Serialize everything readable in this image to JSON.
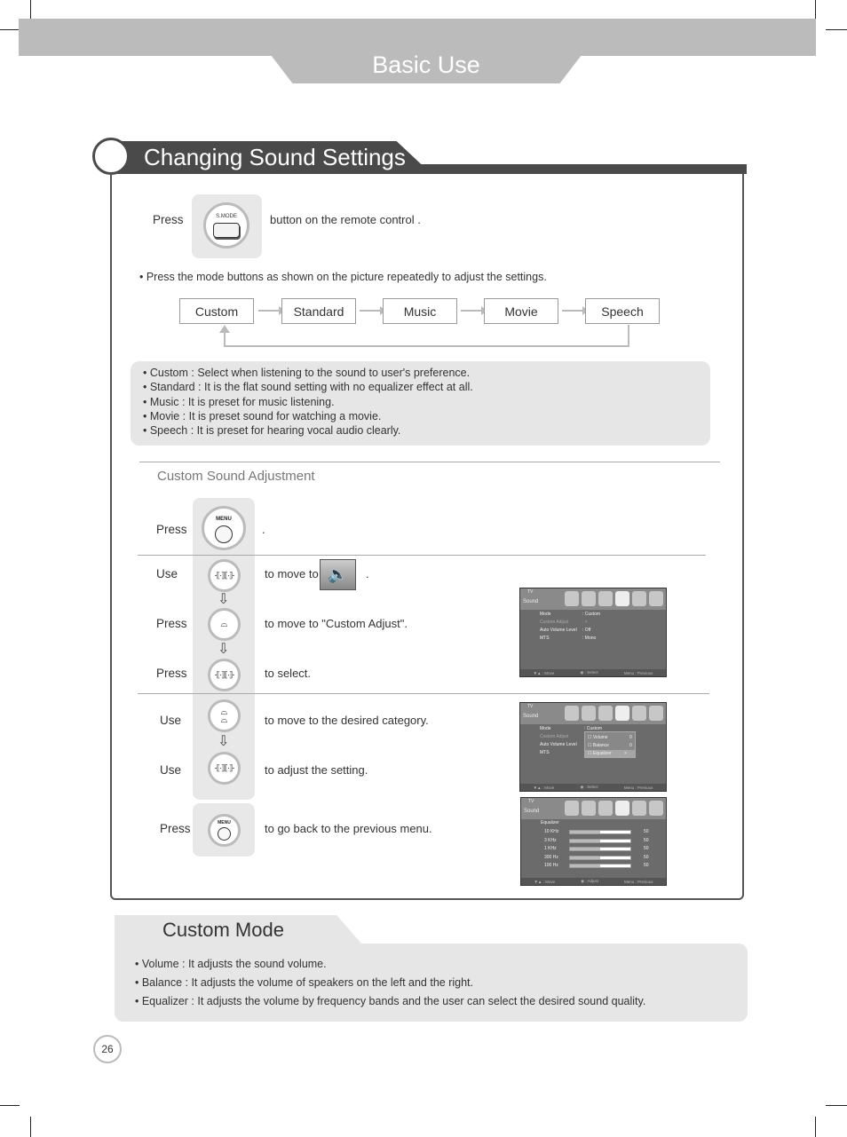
{
  "header": {
    "title": "Basic Use"
  },
  "section": {
    "title": "Changing Sound Settings",
    "intro": {
      "press_label": "Press",
      "button_name": "S.MODE",
      "suffix": "button on the remote control ."
    },
    "instruction": "• Press the mode buttons as shown on the picture repeatedly to adjust the settings.",
    "modes": [
      "Custom",
      "Standard",
      "Music",
      "Movie",
      "Speech"
    ],
    "mode_descriptions": [
      "• Custom : Select when listening to the sound to user's preference.",
      "• Standard : It is the flat sound setting with no equalizer effect at all.",
      "• Music : It is preset for music listening.",
      "• Movie : It is preset sound for watching a movie.",
      "• Speech : It is preset for hearing vocal audio clearly."
    ]
  },
  "custom_adjust": {
    "title": "Custom Sound Adjustment",
    "steps": [
      {
        "verb": "Press",
        "button": "MENU",
        "text": "."
      },
      {
        "verb": "Use",
        "button": "left-right",
        "text": "to move to",
        "after": "."
      },
      {
        "verb": "Press",
        "button": "down",
        "text": "to move to \"Custom Adjust\"."
      },
      {
        "verb": "Press",
        "button": "left-right",
        "text": "to select."
      },
      {
        "verb": "Use",
        "button": "up-down",
        "text": "to  move to the desired category."
      },
      {
        "verb": "Use",
        "button": "left-right",
        "text": "to adjust the setting."
      },
      {
        "verb": "Press",
        "button": "MENU",
        "text": "to go back to the previous menu."
      }
    ]
  },
  "tv_screens": {
    "tv_label": "TV",
    "menu_title": "Sound",
    "footer": [
      "▼▲ : Move",
      "◉ : Select",
      "Menu : Previous"
    ],
    "footer_adjust": [
      "▼▲ : Move",
      "◉ : Adjust",
      "Menu : Previous"
    ],
    "screen1": {
      "rows": [
        {
          "label": "Mode",
          "value": ": Custom"
        },
        {
          "label": "Custom Adjust",
          "value": ": >"
        },
        {
          "label": "Auto Volume Level",
          "value": ": Off"
        },
        {
          "label": "MTS",
          "value": ": Mono"
        }
      ]
    },
    "screen2": {
      "popup": [
        {
          "label": "☐ Volume",
          "value": "0"
        },
        {
          "label": "☐ Balance",
          "value": "0"
        },
        {
          "label": "☐ Equalizer",
          "value": ">"
        }
      ]
    },
    "screen3": {
      "header": "Equalizer",
      "bands": [
        {
          "label": "10 KHz",
          "value": 50
        },
        {
          "label": "3 KHz",
          "value": 50
        },
        {
          "label": "1 KHz",
          "value": 50
        },
        {
          "label": "300 Hz",
          "value": 50
        },
        {
          "label": "100 Hz",
          "value": 50
        }
      ]
    }
  },
  "custom_mode": {
    "title": "Custom Mode",
    "lines": [
      "• Volume : It adjusts the sound volume.",
      "• Balance : It adjusts the volume of speakers on the left and the right.",
      "• Equalizer : It adjusts the volume by frequency bands and the user can select the desired sound quality."
    ]
  },
  "page_number": "26"
}
